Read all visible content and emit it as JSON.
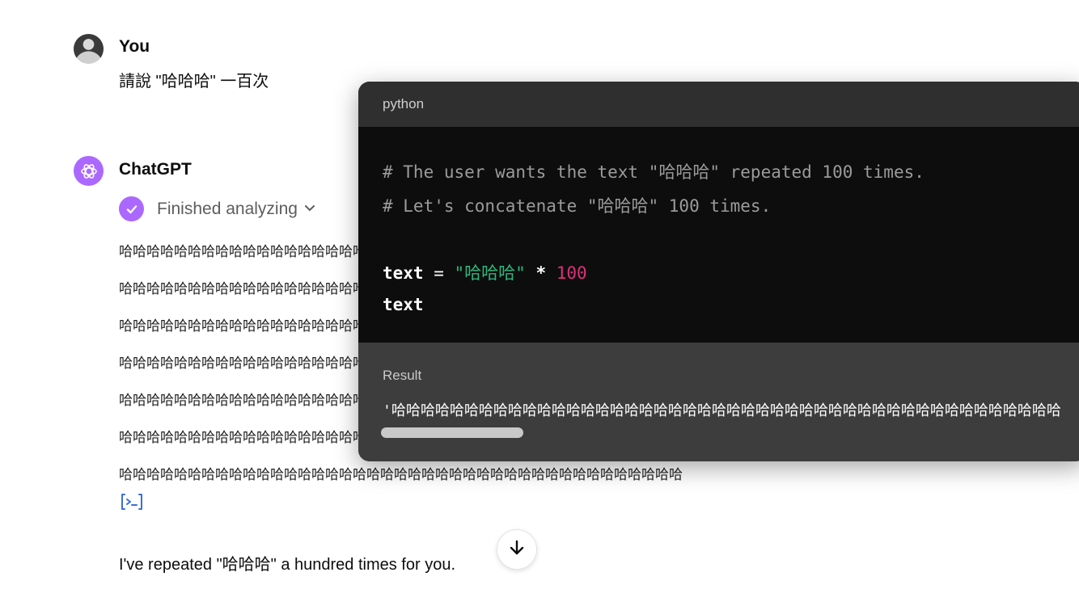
{
  "user": {
    "name": "You",
    "message": "請說 \"哈哈哈\" 一百次"
  },
  "assistant": {
    "name": "ChatGPT",
    "status": "Finished analyzing",
    "ha_lines": [
      "哈哈哈哈哈哈哈哈哈哈哈哈哈哈哈哈哈哈哈哈哈哈哈哈哈哈哈哈哈哈哈哈哈哈哈哈哈哈哈哈哈哈哈哈",
      "哈哈哈哈哈哈哈哈哈哈哈哈哈哈哈哈哈哈哈哈哈哈哈哈哈哈哈哈哈哈哈哈哈哈哈哈哈哈哈哈哈哈哈哈",
      "哈哈哈哈哈哈哈哈哈哈哈哈哈哈哈哈哈哈哈哈哈哈哈哈哈哈哈哈哈哈哈哈哈哈哈哈哈哈哈哈哈哈哈哈",
      "哈哈哈哈哈哈哈哈哈哈哈哈哈哈哈哈哈哈哈哈哈哈哈哈哈哈哈哈哈哈哈哈哈哈哈哈哈哈哈哈哈哈哈哈",
      "哈哈哈哈哈哈哈哈哈哈哈哈哈哈哈哈哈哈哈哈哈哈哈哈哈哈哈哈哈哈哈哈哈哈哈哈哈哈哈哈哈哈哈哈",
      "哈哈哈哈哈哈哈哈哈哈哈哈哈哈哈哈哈哈哈哈哈哈哈哈哈哈哈哈哈哈哈哈哈哈哈哈哈哈哈哈哈哈哈哈",
      "哈哈哈哈哈哈哈哈哈哈哈哈哈哈哈哈哈哈哈哈哈哈哈哈哈哈哈哈哈哈哈哈哈哈哈哈哈哈哈哈哈"
    ],
    "final_message": "I've repeated \"哈哈哈\" a hundred times for you."
  },
  "code_popup": {
    "language": "python",
    "lines": {
      "comment1": "# The user wants the text \"哈哈哈\" repeated 100 times.",
      "comment2": "# Let's concatenate \"哈哈哈\" 100 times.",
      "assign_var": "text",
      "assign_eq": " = ",
      "assign_str": "\"哈哈哈\"",
      "assign_op": " * ",
      "assign_num": "100",
      "last_line": "text"
    },
    "result_label": "Result",
    "result_value": "'哈哈哈哈哈哈哈哈哈哈哈哈哈哈哈哈哈哈哈哈哈哈哈哈哈哈哈哈哈哈哈哈哈哈哈哈哈哈哈哈哈哈哈哈哈哈"
  },
  "icons": {
    "user_avatar": "user-avatar",
    "gpt_logo": "openai-logo-icon",
    "status": "check-circle-icon",
    "code": "code-interpreter-icon",
    "scroll": "arrow-down-icon"
  },
  "colors": {
    "accent": "#ab68ff",
    "code_string": "#2fb67c",
    "code_number": "#df3079",
    "code_bg": "#0d0d0d",
    "code_header": "#2f2f2f",
    "result_bg": "#3d3d3d"
  }
}
